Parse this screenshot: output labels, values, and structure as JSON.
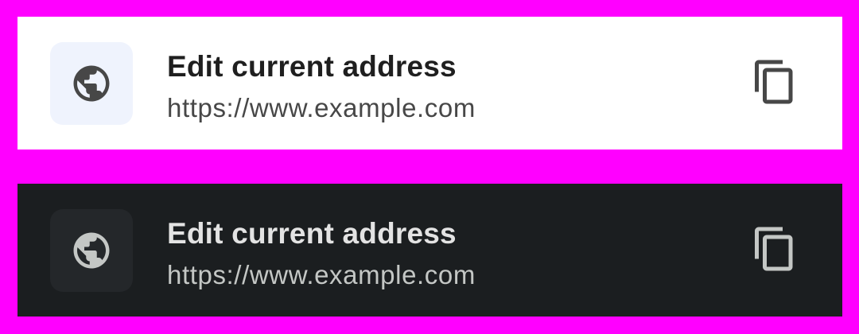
{
  "rows": [
    {
      "theme": "light",
      "icon": "globe-icon",
      "title": "Edit current address",
      "url": "https://www.example.com",
      "action_icon": "copy-icon",
      "colors": {
        "background": "#ffffff",
        "tile": "#eff3fd",
        "icon": "#474747",
        "title": "#1f1f1f",
        "url": "#474747"
      }
    },
    {
      "theme": "dark",
      "icon": "globe-icon",
      "title": "Edit current address",
      "url": "https://www.example.com",
      "action_icon": "copy-icon",
      "colors": {
        "background": "#1b1e20",
        "tile": "#24272a",
        "icon": "#c4c7c5",
        "title": "#e3e3e3",
        "url": "#c4c7c5"
      }
    }
  ],
  "page_background": "#ff00ff"
}
